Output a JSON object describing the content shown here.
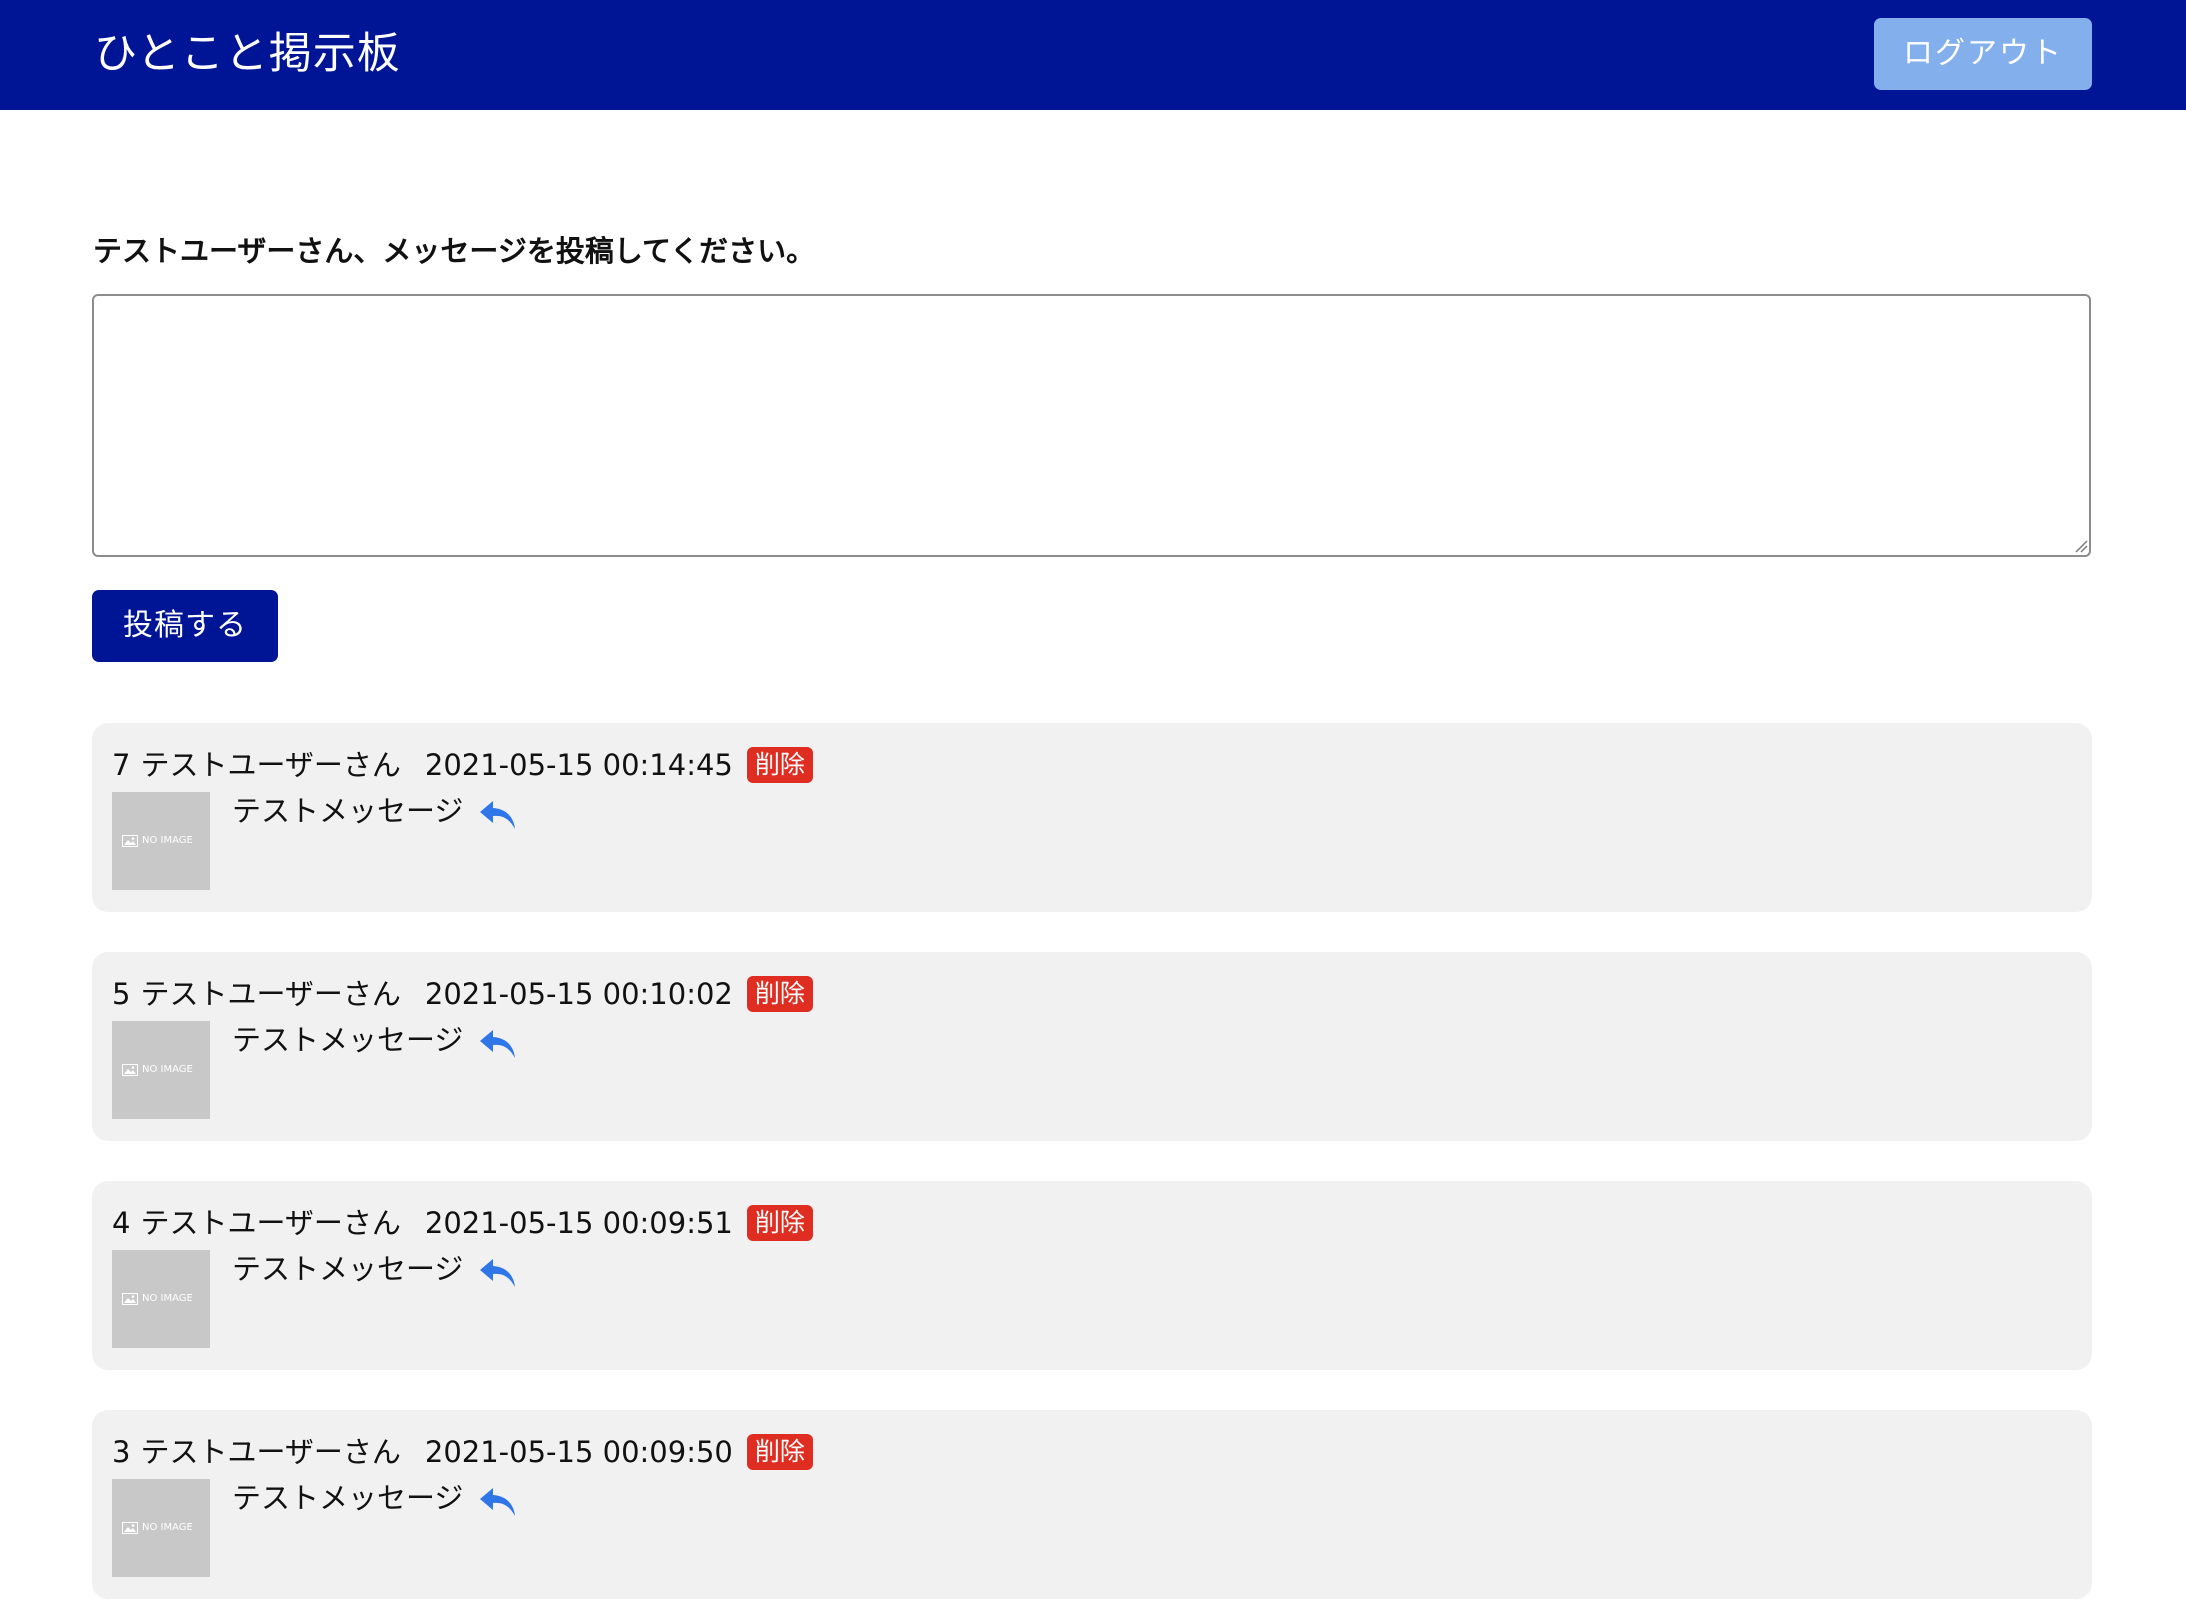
{
  "header": {
    "title": "ひとこと掲示板",
    "logout_label": "ログアウト"
  },
  "form": {
    "prompt": "テストユーザーさん、メッセージを投稿してください。",
    "textarea_value": "",
    "submit_label": "投稿する"
  },
  "colors": {
    "header_bg": "#001496",
    "logout_bg": "#83afec",
    "delete_badge": "#e02d22",
    "reply_icon": "#2f76e8",
    "card_bg": "#f1f1f1"
  },
  "posts": [
    {
      "number": "7",
      "author": "テストユーザーさん",
      "datetime": "2021-05-15 00:14:45",
      "delete_label": "削除",
      "image_text": "NO IMAGE",
      "message": "テストメッセージ",
      "reply_icon": "reply-icon"
    },
    {
      "number": "5",
      "author": "テストユーザーさん",
      "datetime": "2021-05-15 00:10:02",
      "delete_label": "削除",
      "image_text": "NO IMAGE",
      "message": "テストメッセージ",
      "reply_icon": "reply-icon"
    },
    {
      "number": "4",
      "author": "テストユーザーさん",
      "datetime": "2021-05-15 00:09:51",
      "delete_label": "削除",
      "image_text": "NO IMAGE",
      "message": "テストメッセージ",
      "reply_icon": "reply-icon"
    },
    {
      "number": "3",
      "author": "テストユーザーさん",
      "datetime": "2021-05-15 00:09:50",
      "delete_label": "削除",
      "image_text": "NO IMAGE",
      "message": "テストメッセージ",
      "reply_icon": "reply-icon"
    }
  ]
}
